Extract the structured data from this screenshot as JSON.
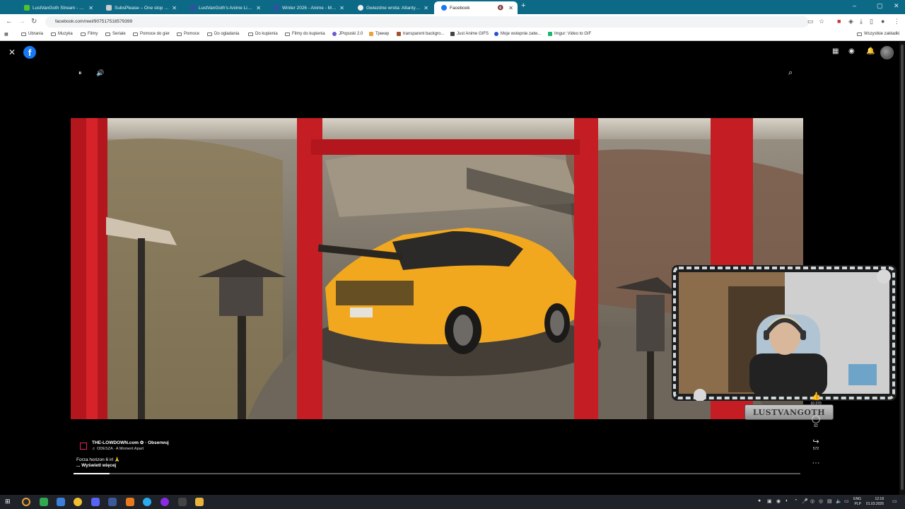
{
  "browser": {
    "tabs": [
      {
        "label": "LustVanGoth Stream - Watch L",
        "fav": "#53c22b"
      },
      {
        "label": "SubsPlease – One stop shop fo",
        "fav": "#cccccc"
      },
      {
        "label": "LustVanGoth's Anime List - My",
        "fav": "#2e51a2"
      },
      {
        "label": "Winter 2026 - Anime - MyAnim",
        "fav": "#2e51a2"
      },
      {
        "label": "Gwiezdne wrota: Atlantyda / Sta",
        "fav": "#e33"
      },
      {
        "label": "Facebook",
        "fav": "#1877f2"
      }
    ],
    "url": "facebook.com/reel/907517518579399",
    "bookmarks": [
      "Ubrania",
      "Muzyka",
      "Filmy",
      "Seriale",
      "Pomoce do gier",
      "Pomoce",
      "Do ogladania",
      "Do kupienia",
      "Filmy do kupienia",
      "JPopuski 2.0",
      "Трекер",
      "transparent backgro...",
      "Just Anime GIFS",
      "Moje wstepnie zatw...",
      "Imgur: Video to GIF"
    ],
    "bookmarks_all": "Wszystkie zakładki"
  },
  "reel": {
    "author": "THE-LOWDOWN.com ✿ · Obserwuj",
    "music": "♬ ODESZA · A Moment Apart",
    "description": "Forza horizon 6 irl 🙏",
    "see_more": "... Wyświetl więcej",
    "likes": "10 370",
    "comments": "62",
    "shares": "572",
    "progress": 0.05
  },
  "overlay": {
    "streamer_name": "LUSTVANGOTH"
  },
  "taskbar": {
    "lang_top": "ENG",
    "lang_bottom": "PLP",
    "time": "12:18",
    "date": "01.03.2026"
  }
}
